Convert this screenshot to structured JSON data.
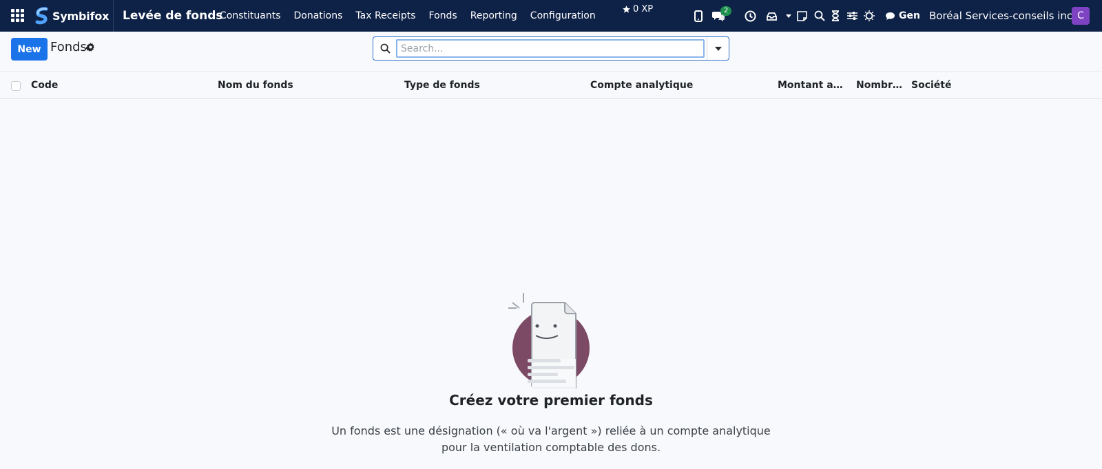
{
  "navbar": {
    "brand": "Symbifox",
    "app_title": "Levée de fonds",
    "menu": [
      {
        "label": "Constituants"
      },
      {
        "label": "Donations"
      },
      {
        "label": "Tax Receipts"
      },
      {
        "label": "Fonds"
      },
      {
        "label": "Reporting"
      },
      {
        "label": "Configuration"
      }
    ],
    "xp": "0 XP",
    "chat_count": "2",
    "gen_label": "Gen",
    "company": "Boréal Services-conseils inc.",
    "avatar_letter": "C",
    "colors": {
      "background": "#0e2146",
      "avatar": "#7d43c2",
      "badge": "#1f8f4e"
    }
  },
  "control": {
    "new_label": "New",
    "breadcrumb_title": "Fonds",
    "search_placeholder": "Search..."
  },
  "list": {
    "columns": [
      {
        "label": "Code"
      },
      {
        "label": "Nom du fonds"
      },
      {
        "label": "Type de fonds"
      },
      {
        "label": "Compte analytique"
      },
      {
        "label": "Montant amassé"
      },
      {
        "label": "Nombre de dons"
      },
      {
        "label": "Société"
      }
    ]
  },
  "empty_state": {
    "title": "Créez votre premier fonds",
    "line1": "Un fonds est une désignation (« où va l'argent ») reliée à un compte analytique",
    "line2": "pour la ventilation comptable des dons."
  },
  "icons": [
    "apps-grid-icon",
    "symbifox-logo-icon",
    "star-icon",
    "mobile-phone-icon",
    "chat-bubbles-icon",
    "clock-icon",
    "inbox-icon",
    "caret-down-icon",
    "sticky-note-icon",
    "search-icon",
    "hourglass-icon",
    "sliders-icon",
    "sun-icon",
    "comment-icon",
    "gear-icon",
    "empty-document-icon"
  ]
}
